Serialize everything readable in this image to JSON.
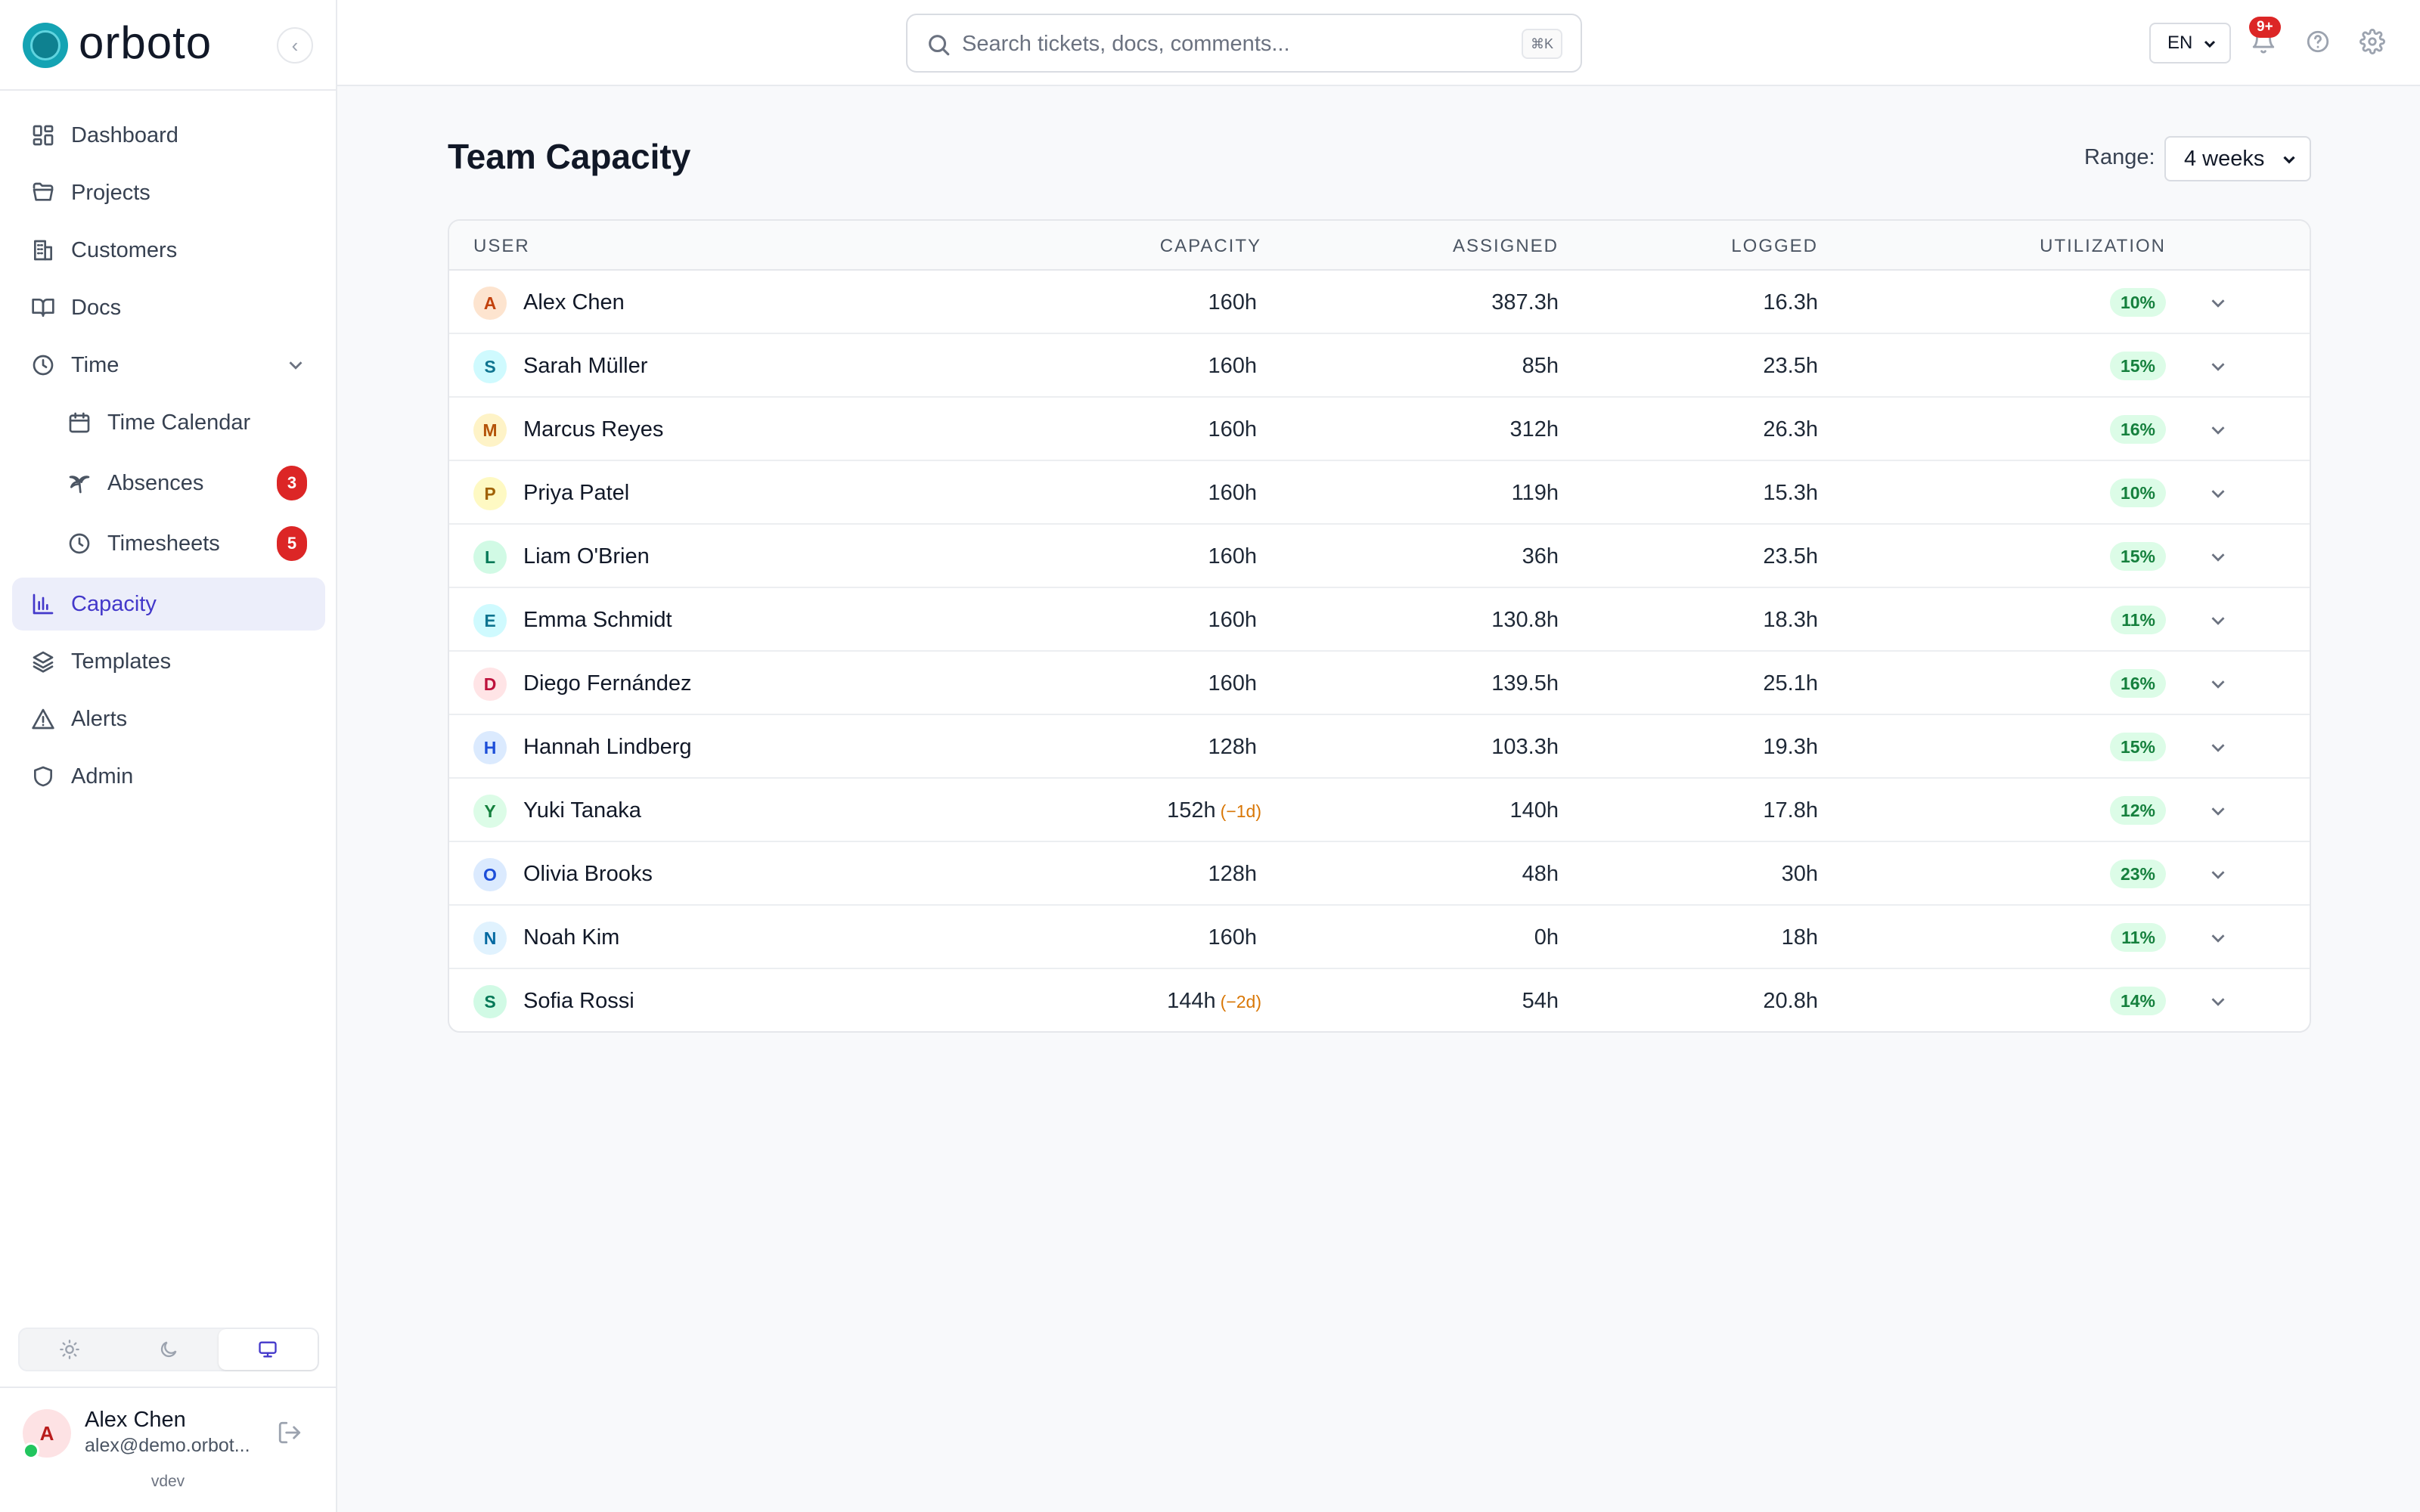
{
  "brand": {
    "name": "orboto"
  },
  "nav": {
    "dashboard": "Dashboard",
    "projects": "Projects",
    "customers": "Customers",
    "docs": "Docs",
    "time": "Time",
    "time_calendar": "Time Calendar",
    "absences": "Absences",
    "absences_badge": "3",
    "timesheets": "Timesheets",
    "timesheets_badge": "5",
    "capacity": "Capacity",
    "templates": "Templates",
    "alerts": "Alerts",
    "admin": "Admin"
  },
  "theme": {
    "selected": "system"
  },
  "user": {
    "initial": "A",
    "name": "Alex Chen",
    "email": "alex@demo.orbot...",
    "version": "vdev"
  },
  "topbar": {
    "search_placeholder": "Search tickets, docs, comments...",
    "search_shortcut": "⌘K",
    "language": "EN",
    "notifications_badge": "9+"
  },
  "page": {
    "title": "Team Capacity",
    "range_label": "Range:",
    "range_value": "4 weeks"
  },
  "table": {
    "headers": {
      "user": "USER",
      "capacity": "CAPACITY",
      "assigned": "ASSIGNED",
      "logged": "LOGGED",
      "utilization": "UTILIZATION"
    },
    "rows": [
      {
        "initial": "A",
        "name": "Alex Chen",
        "capacity": "160h",
        "capacity_adj": "",
        "assigned": "387.3h",
        "logged": "16.3h",
        "utilization": "10%",
        "avatar_bg": "#fde4cf",
        "avatar_fg": "#c2410c"
      },
      {
        "initial": "S",
        "name": "Sarah Müller",
        "capacity": "160h",
        "capacity_adj": "",
        "assigned": "85h",
        "logged": "23.5h",
        "utilization": "15%",
        "avatar_bg": "#cffafe",
        "avatar_fg": "#0e7490"
      },
      {
        "initial": "M",
        "name": "Marcus Reyes",
        "capacity": "160h",
        "capacity_adj": "",
        "assigned": "312h",
        "logged": "26.3h",
        "utilization": "16%",
        "avatar_bg": "#fef3c7",
        "avatar_fg": "#b45309"
      },
      {
        "initial": "P",
        "name": "Priya Patel",
        "capacity": "160h",
        "capacity_adj": "",
        "assigned": "119h",
        "logged": "15.3h",
        "utilization": "10%",
        "avatar_bg": "#fef9c3",
        "avatar_fg": "#a16207"
      },
      {
        "initial": "L",
        "name": "Liam O'Brien",
        "capacity": "160h",
        "capacity_adj": "",
        "assigned": "36h",
        "logged": "23.5h",
        "utilization": "15%",
        "avatar_bg": "#d1fae5",
        "avatar_fg": "#047857"
      },
      {
        "initial": "E",
        "name": "Emma Schmidt",
        "capacity": "160h",
        "capacity_adj": "",
        "assigned": "130.8h",
        "logged": "18.3h",
        "utilization": "11%",
        "avatar_bg": "#cffafe",
        "avatar_fg": "#0e7490"
      },
      {
        "initial": "D",
        "name": "Diego Fernández",
        "capacity": "160h",
        "capacity_adj": "",
        "assigned": "139.5h",
        "logged": "25.1h",
        "utilization": "16%",
        "avatar_bg": "#ffe4e6",
        "avatar_fg": "#be123c"
      },
      {
        "initial": "H",
        "name": "Hannah Lindberg",
        "capacity": "128h",
        "capacity_adj": "",
        "assigned": "103.3h",
        "logged": "19.3h",
        "utilization": "15%",
        "avatar_bg": "#dbeafe",
        "avatar_fg": "#1d4ed8"
      },
      {
        "initial": "Y",
        "name": "Yuki Tanaka",
        "capacity": "152h",
        "capacity_adj": "(−1d)",
        "assigned": "140h",
        "logged": "17.8h",
        "utilization": "12%",
        "avatar_bg": "#dcfce7",
        "avatar_fg": "#15803d"
      },
      {
        "initial": "O",
        "name": "Olivia Brooks",
        "capacity": "128h",
        "capacity_adj": "",
        "assigned": "48h",
        "logged": "30h",
        "utilization": "23%",
        "avatar_bg": "#dbeafe",
        "avatar_fg": "#1d4ed8"
      },
      {
        "initial": "N",
        "name": "Noah Kim",
        "capacity": "160h",
        "capacity_adj": "",
        "assigned": "0h",
        "logged": "18h",
        "utilization": "11%",
        "avatar_bg": "#e0f2fe",
        "avatar_fg": "#0369a1"
      },
      {
        "initial": "S",
        "name": "Sofia Rossi",
        "capacity": "144h",
        "capacity_adj": "(−2d)",
        "assigned": "54h",
        "logged": "20.8h",
        "utilization": "14%",
        "avatar_bg": "#d1fae5",
        "avatar_fg": "#047857"
      }
    ]
  },
  "colors": {
    "accent": "#4338ca",
    "brand": "#14a3b3",
    "badge": "#dc2626",
    "utilization_bg": "#dcfce7",
    "utilization_fg": "#15803d",
    "capacity_adjustment": "#d97706"
  }
}
